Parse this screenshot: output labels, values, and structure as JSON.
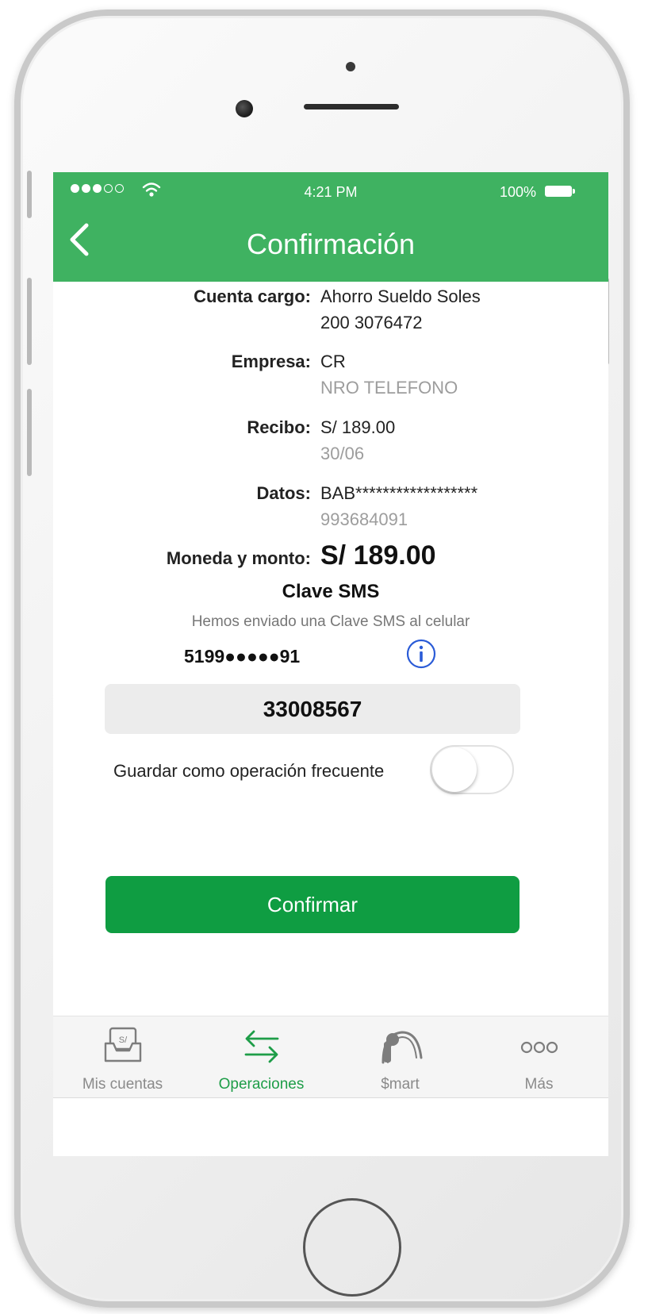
{
  "status_bar": {
    "time": "4:21 PM",
    "battery": "100%"
  },
  "header": {
    "title": "Confirmación"
  },
  "details": {
    "cuenta_cargo": {
      "label": "Cuenta cargo:",
      "line1": "Ahorro Sueldo Soles",
      "line2": "200 3076472"
    },
    "empresa": {
      "label": "Empresa:",
      "line1": "CR",
      "line2": "NRO TELEFONO"
    },
    "recibo": {
      "label": "Recibo:",
      "line1": "S/ 189.00",
      "line2": "30/06"
    },
    "datos": {
      "label": "Datos:",
      "line1": "BAB******************",
      "line2": "993684091"
    },
    "moneda_monto": {
      "label": "Moneda y monto:",
      "value": "S/ 189.00"
    }
  },
  "sms": {
    "title": "Clave SMS",
    "description": "Hemos enviado una Clave SMS al celular",
    "phone": "5199●●●●●91",
    "code": "33008567"
  },
  "frequent": {
    "label": "Guardar como operación frecuente",
    "enabled": false
  },
  "confirm_button": {
    "label": "Confirmar"
  },
  "tabs": [
    {
      "label": "Mis cuentas",
      "icon": "wallet-icon",
      "active": false
    },
    {
      "label": "Operaciones",
      "icon": "transfer-arrows-icon",
      "active": true
    },
    {
      "label": "$mart",
      "icon": "smart-key-icon",
      "active": false
    },
    {
      "label": "Más",
      "icon": "more-dots-icon",
      "active": false
    }
  ],
  "colors": {
    "header": "#3fb261",
    "confirm": "#0f9d42",
    "active_tab": "#1e9d48",
    "info": "#2a5bd7"
  }
}
